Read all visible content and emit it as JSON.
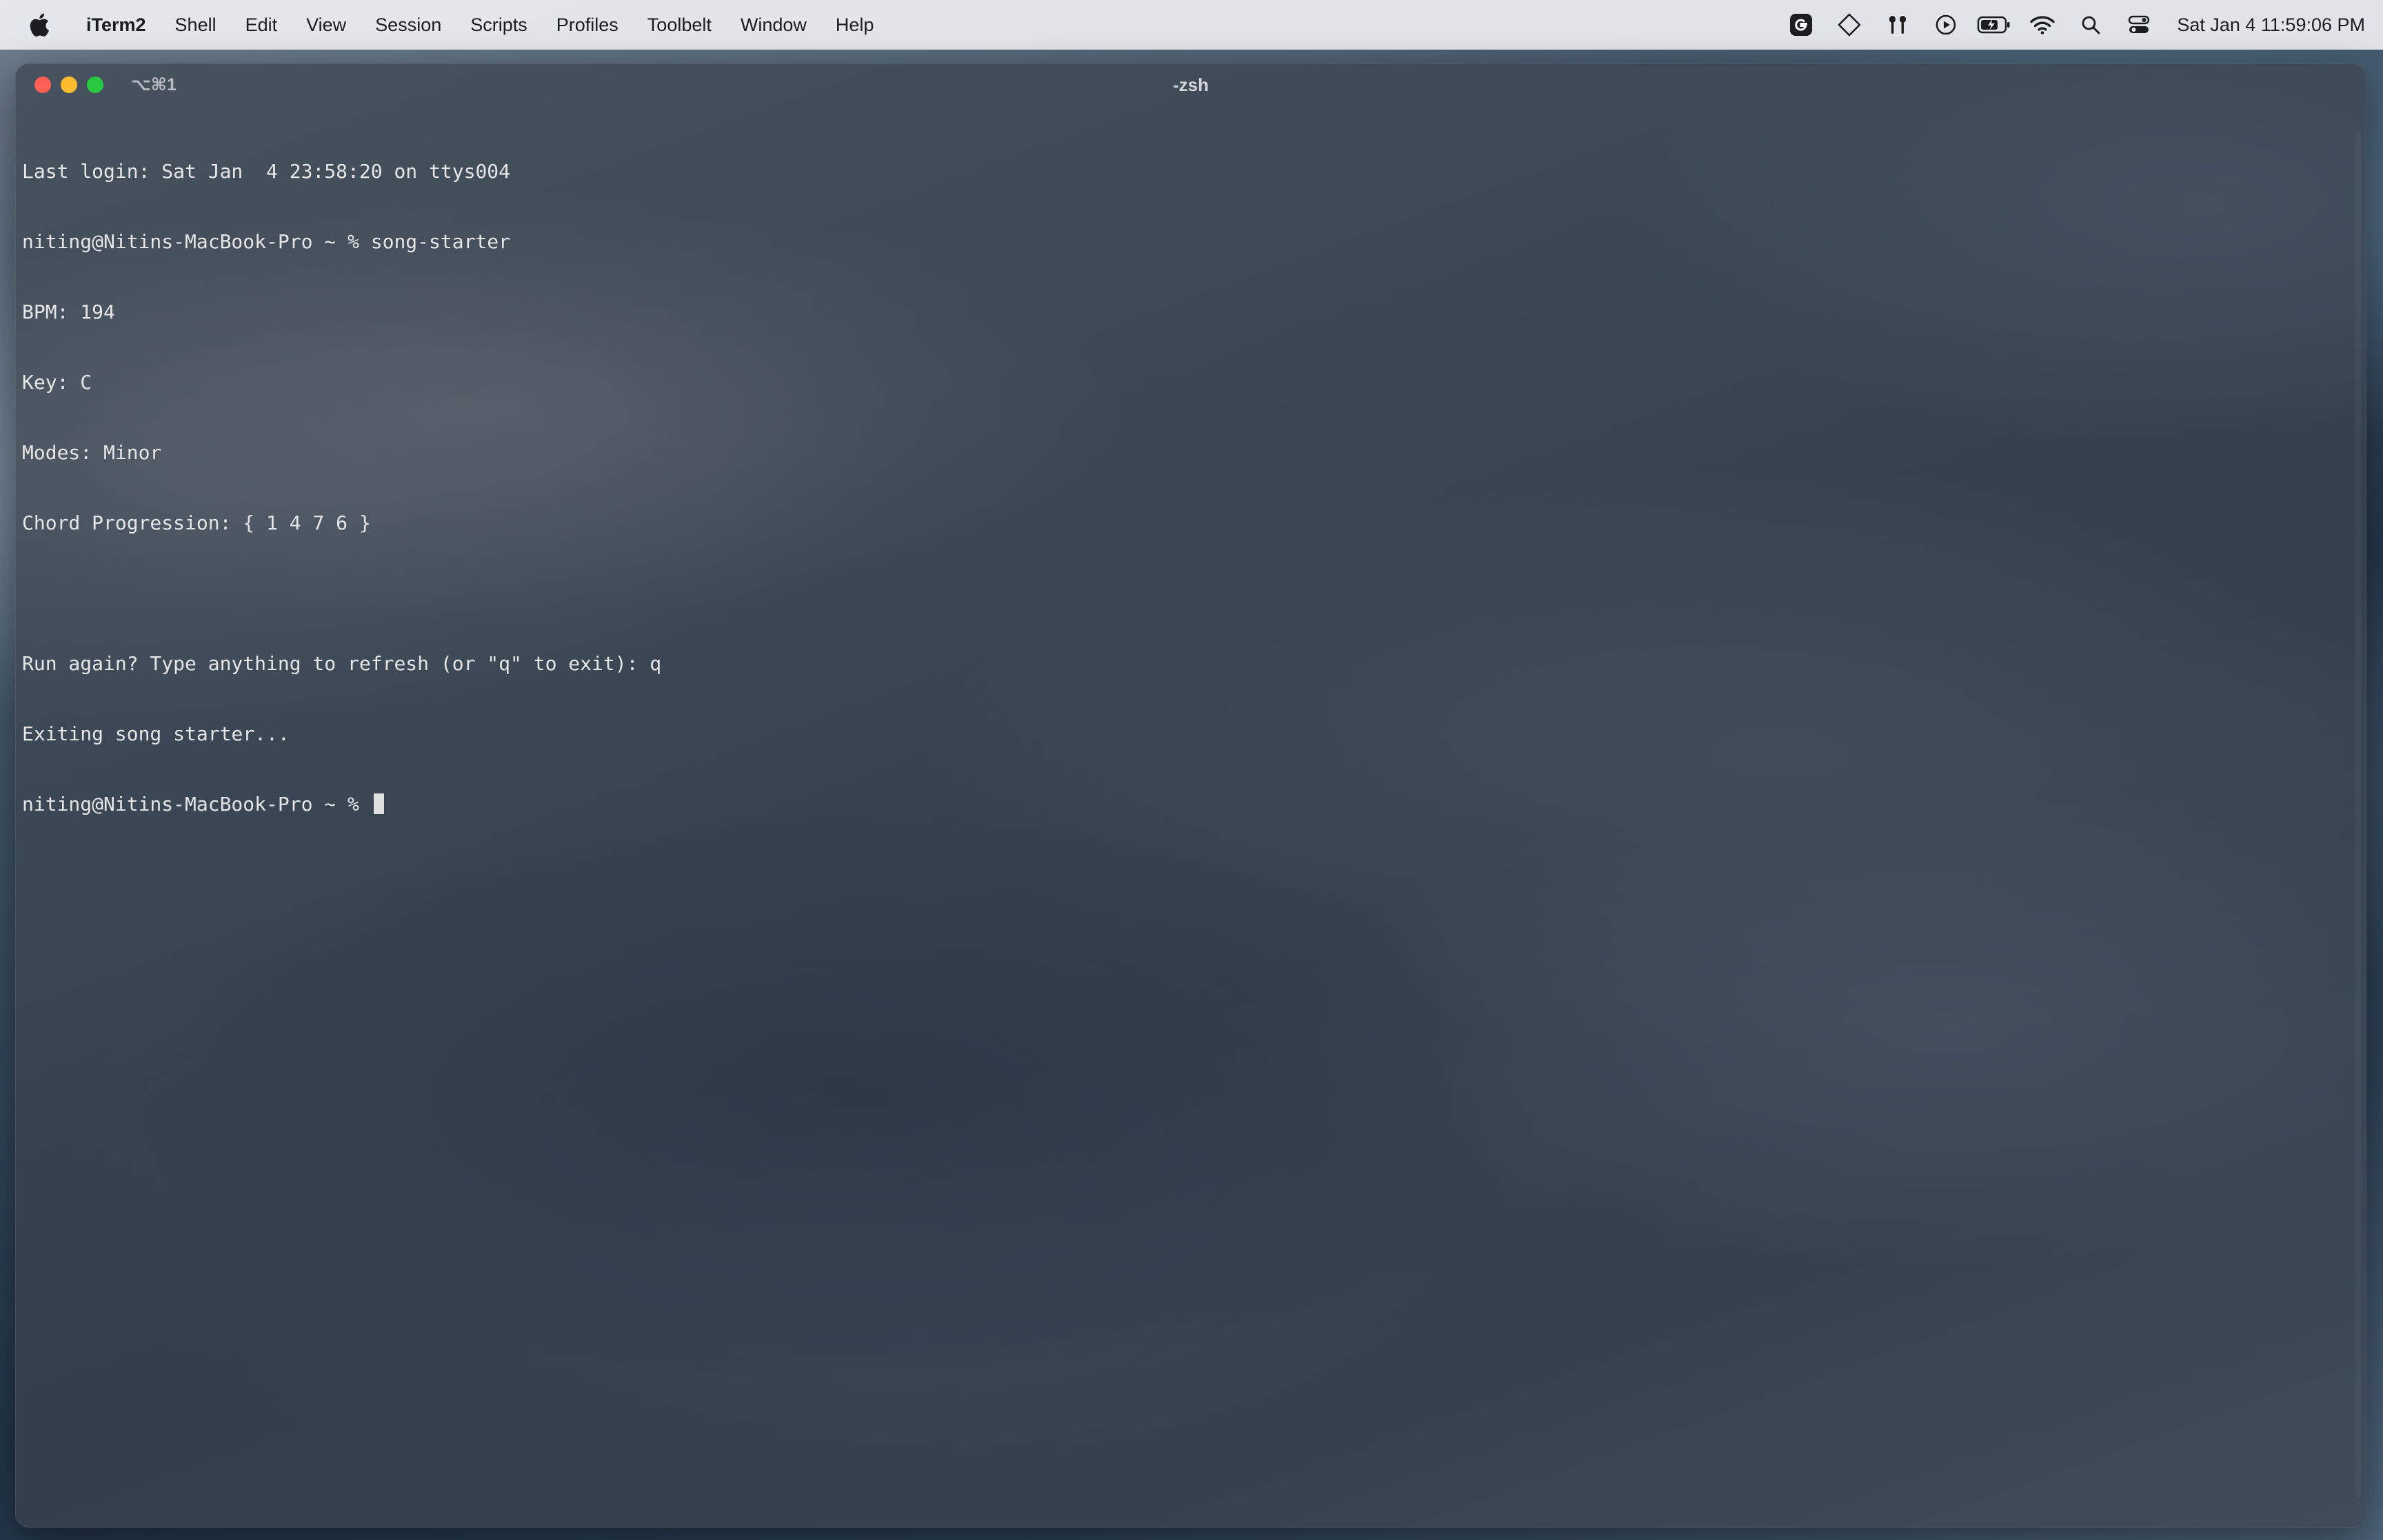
{
  "menubar": {
    "apple_icon": "apple-logo",
    "app_name": "iTerm2",
    "items": [
      "Shell",
      "Edit",
      "View",
      "Session",
      "Scripts",
      "Profiles",
      "Toolbelt",
      "Window",
      "Help"
    ],
    "status_icons": [
      "grammarly-icon",
      "diamond-icon",
      "airpods-icon",
      "play-icon",
      "battery-icon",
      "wifi-icon",
      "search-icon",
      "control-center-icon"
    ],
    "clock": "Sat Jan 4  11:59:06 PM"
  },
  "window": {
    "tab_shortcut": "⌥⌘1",
    "title": "-zsh",
    "lines": [
      "Last login: Sat Jan  4 23:58:20 on ttys004",
      "niting@Nitins-MacBook-Pro ~ % song-starter",
      "BPM: 194",
      "Key: C",
      "Modes: Minor",
      "Chord Progression: { 1 4 7 6 }",
      "",
      "Run again? Type anything to refresh (or \"q\" to exit): q",
      "Exiting song starter...",
      "niting@Nitins-MacBook-Pro ~ % "
    ]
  }
}
